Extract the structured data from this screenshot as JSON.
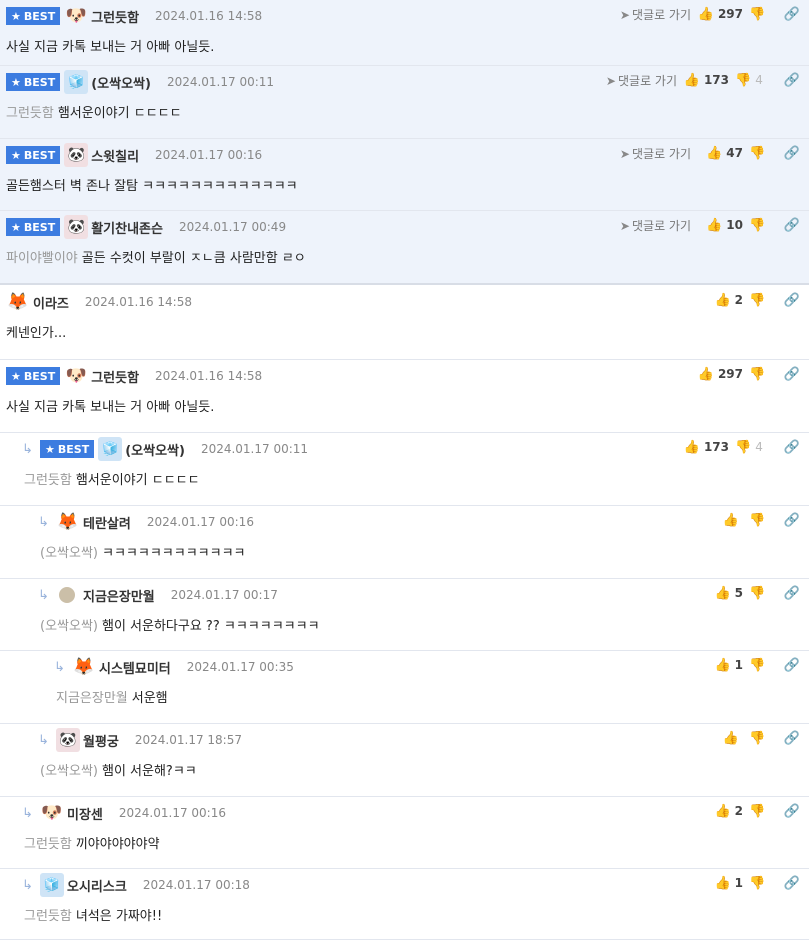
{
  "ui": {
    "best_label": "BEST",
    "goto_label": "댓글로 가기"
  },
  "comments": [
    {
      "best": true,
      "nick": "그런듯함",
      "date": "2024.01.16 14:58",
      "ref": "",
      "text": "사실 지금 카톡 보내는 거 아빠 아닐듯.",
      "likes": "297",
      "dislikes": "",
      "goto": true,
      "avatar": "🐶",
      "av_class": ""
    },
    {
      "best": true,
      "nick": "(오싹오싹)",
      "date": "2024.01.17 00:11",
      "ref": "그런듯함",
      "text": "햄서운이야기 ㄷㄷㄷㄷ",
      "likes": "173",
      "dislikes": "4",
      "goto": true,
      "avatar": "🧊",
      "av_class": "ice"
    },
    {
      "best": true,
      "nick": "스윗칠리",
      "date": "2024.01.17 00:16",
      "ref": "",
      "text": "골든햄스터 벽 존나 잘탐 ㅋㅋㅋㅋㅋㅋㅋㅋㅋㅋㅋㅋㅋ",
      "likes": "47",
      "dislikes": "",
      "goto": true,
      "avatar": "🐼",
      "av_class": "red"
    },
    {
      "best": true,
      "nick": "활기찬내존슨",
      "date": "2024.01.17 00:49",
      "ref": "파이야빨이야",
      "text": "골든 수컷이 부랄이 ㅈㄴ큼 사람만함 ㄹㅇ",
      "likes": "10",
      "dislikes": "",
      "goto": true,
      "avatar": "🐼",
      "av_class": "red"
    },
    {
      "best": false,
      "nick": "이라즈",
      "date": "2024.01.16 14:58",
      "ref": "",
      "text": "케넨인가...",
      "likes": "2",
      "dislikes": "",
      "goto": false,
      "avatar": "🦊",
      "av_class": ""
    },
    {
      "best": true,
      "nick": "그런듯함",
      "date": "2024.01.16 14:58",
      "ref": "",
      "text": "사실 지금 카톡 보내는 거 아빠 아닐듯.",
      "likes": "297",
      "dislikes": "",
      "goto": false,
      "avatar": "🐶",
      "av_class": ""
    },
    {
      "best": true,
      "nick": "(오싹오싹)",
      "date": "2024.01.17 00:11",
      "ref": "그런듯함",
      "text": "햄서운이야기 ㄷㄷㄷㄷ",
      "likes": "173",
      "dislikes": "4",
      "goto": false,
      "avatar": "🧊",
      "av_class": "ice"
    },
    {
      "best": false,
      "nick": "테란살려",
      "date": "2024.01.17 00:16",
      "ref": "(오싹오싹)",
      "text": "ㅋㅋㅋㅋㅋㅋㅋㅋㅋㅋㅋㅋ",
      "likes": "",
      "dislikes": "",
      "goto": false,
      "avatar": "🦊",
      "av_class": ""
    },
    {
      "best": false,
      "nick": "지금은장만월",
      "date": "2024.01.17 00:17",
      "ref": "(오싹오싹)",
      "text": "햄이 서운하다구요 ?? ㅋㅋㅋㅋㅋㅋㅋㅋ",
      "likes": "5",
      "dislikes": "",
      "goto": false,
      "avatar": "",
      "av_class": "dot"
    },
    {
      "best": false,
      "nick": "시스템묘미터",
      "date": "2024.01.17 00:35",
      "ref": "지금은장만월",
      "text": "서운햄",
      "likes": "1",
      "dislikes": "",
      "goto": false,
      "avatar": "🦊",
      "av_class": ""
    },
    {
      "best": false,
      "nick": "월평궁",
      "date": "2024.01.17 18:57",
      "ref": "(오싹오싹)",
      "text": "햄이 서운해?ㅋㅋ",
      "likes": "",
      "dislikes": "",
      "goto": false,
      "avatar": "🐼",
      "av_class": "red"
    },
    {
      "best": false,
      "nick": "미장센",
      "date": "2024.01.17 00:16",
      "ref": "그런듯함",
      "text": "끼야야야야야약",
      "likes": "2",
      "dislikes": "",
      "goto": false,
      "avatar": "🐶",
      "av_class": ""
    },
    {
      "best": false,
      "nick": "오시리스크",
      "date": "2024.01.17 00:18",
      "ref": "그런듯함",
      "text": "녀석은 가짜야!!",
      "likes": "1",
      "dislikes": "",
      "goto": false,
      "avatar": "🧊",
      "av_class": "ice"
    }
  ]
}
